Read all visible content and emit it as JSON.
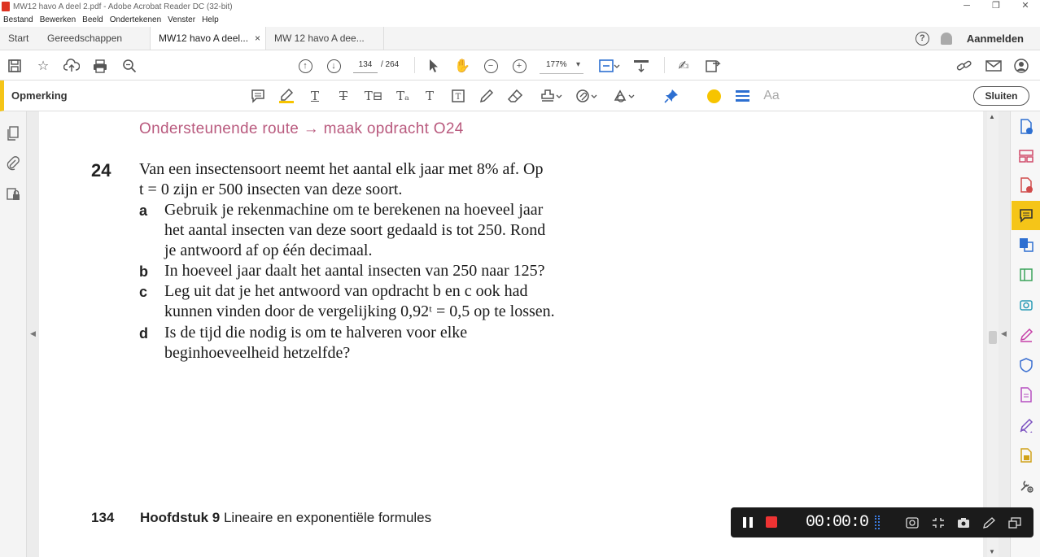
{
  "window": {
    "title": "MW12 havo A deel 2.pdf - Adobe Acrobat Reader DC (32-bit)",
    "controls": [
      "─",
      "❐",
      "✕"
    ]
  },
  "menu": [
    "Bestand",
    "Bewerken",
    "Beeld",
    "Ondertekenen",
    "Venster",
    "Help"
  ],
  "tabs": {
    "home": "Start",
    "tools": "Gereedschappen",
    "doc1": "MW12 havo A deel...",
    "doc2": "MW 12 havo A dee...",
    "close": "×",
    "signin": "Aanmelden",
    "help": "?"
  },
  "toolbar": {
    "page_current": "134",
    "page_total": "/ 264",
    "zoom": "177%"
  },
  "commentbar": {
    "label": "Opmerking",
    "close_label": "Sluiten",
    "font_label": "Aa",
    "highlight_color": "#f7c400",
    "line_color": "#2d6fd1"
  },
  "document": {
    "route": "Ondersteunende route → maak opdracht O24",
    "question_number": "24",
    "intro_line1": "Van een insectensoort neemt het aantal elk jaar met 8% af. Op",
    "intro_line2": "t = 0 zijn er 500 insecten van deze soort.",
    "subquestions": [
      {
        "label": "a",
        "lines": [
          "Gebruik je rekenmachine om te berekenen na hoeveel jaar",
          "het aantal insecten van deze soort gedaald is tot 250. Rond",
          "je antwoord af op één decimaal."
        ]
      },
      {
        "label": "b",
        "lines": [
          "In hoeveel jaar daalt het aantal insecten van 250 naar 125?"
        ]
      },
      {
        "label": "c",
        "lines": [
          "Leg uit dat je het antwoord van opdracht b en c ook had",
          "kunnen vinden door de vergelijking 0,92ᵗ = 0,5 op te lossen."
        ]
      },
      {
        "label": "d",
        "lines": [
          "Is de tijd die nodig is om te halveren voor elke",
          "beginhoeveelheid hetzelfde?"
        ]
      }
    ],
    "footer_page": "134",
    "footer_chapter": "Hoofdstuk 9",
    "footer_title": "Lineaire en exponentiële formules"
  },
  "recorder": {
    "time": "00:00:0",
    "stop_color": "#e33333"
  }
}
